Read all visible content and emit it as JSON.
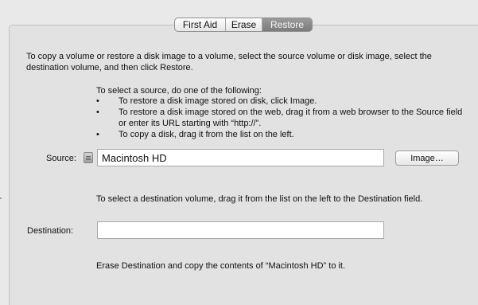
{
  "tabs": [
    {
      "label": "First Aid",
      "selected": false
    },
    {
      "label": "Erase",
      "selected": false
    },
    {
      "label": "Restore",
      "selected": true
    }
  ],
  "restore": {
    "instructions": "To copy a volume or restore a disk image to a volume, select the source volume or disk image, select the destination volume, and then click Restore.",
    "select_source_intro": "To select a source, do one of the following:",
    "bullets": [
      "To restore a disk image stored on disk, click Image.",
      "To restore a disk image stored on the web, drag it from a web browser to the Source field or enter its URL starting with “http://”.",
      "To copy a disk, drag it from the list on the left."
    ],
    "bullet_symbol": "•",
    "source": {
      "label": "Source:",
      "value": "Macintosh HD",
      "icon": "disk-icon"
    },
    "image_button": "Image…",
    "destination_intro": "To select a destination volume, drag it from the list on the left to the Destination field.",
    "destination": {
      "label": "Destination:",
      "value": ""
    },
    "summary": "Erase Destination and copy the contents of “Macintosh HD” to it."
  }
}
